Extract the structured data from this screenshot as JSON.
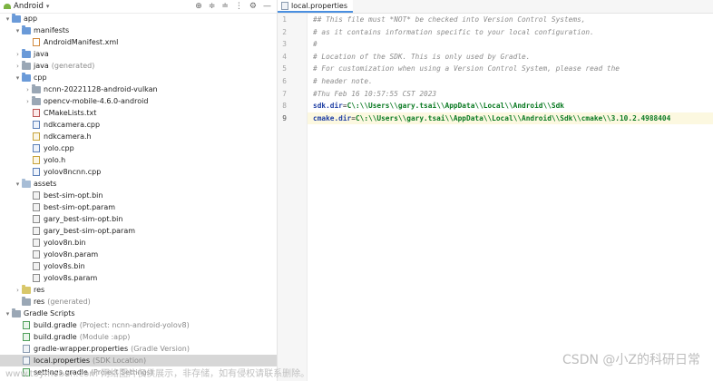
{
  "project_panel": {
    "view_selector": "Android",
    "tree": [
      {
        "depth": 0,
        "arrow": "▾",
        "icon": "folder-blue",
        "label": "app",
        "suffix": ""
      },
      {
        "depth": 1,
        "arrow": "▾",
        "icon": "folder-blue",
        "label": "manifests",
        "suffix": ""
      },
      {
        "depth": 2,
        "arrow": "",
        "icon": "file-xml",
        "label": "AndroidManifest.xml",
        "suffix": ""
      },
      {
        "depth": 1,
        "arrow": "›",
        "icon": "folder-blue",
        "label": "java",
        "suffix": ""
      },
      {
        "depth": 1,
        "arrow": "›",
        "icon": "folder-grey",
        "label": "java",
        "suffix": "(generated)"
      },
      {
        "depth": 1,
        "arrow": "▾",
        "icon": "folder-blue",
        "label": "cpp",
        "suffix": ""
      },
      {
        "depth": 2,
        "arrow": "›",
        "icon": "folder-grey",
        "label": "ncnn-20221128-android-vulkan",
        "suffix": ""
      },
      {
        "depth": 2,
        "arrow": "›",
        "icon": "folder-grey",
        "label": "opencv-mobile-4.6.0-android",
        "suffix": ""
      },
      {
        "depth": 2,
        "arrow": "",
        "icon": "file-txt",
        "label": "CMakeLists.txt",
        "suffix": ""
      },
      {
        "depth": 2,
        "arrow": "",
        "icon": "file-cpp",
        "label": "ndkcamera.cpp",
        "suffix": ""
      },
      {
        "depth": 2,
        "arrow": "",
        "icon": "file-h",
        "label": "ndkcamera.h",
        "suffix": ""
      },
      {
        "depth": 2,
        "arrow": "",
        "icon": "file-cpp",
        "label": "yolo.cpp",
        "suffix": ""
      },
      {
        "depth": 2,
        "arrow": "",
        "icon": "file-h",
        "label": "yolo.h",
        "suffix": ""
      },
      {
        "depth": 2,
        "arrow": "",
        "icon": "file-cpp",
        "label": "yolov8ncnn.cpp",
        "suffix": ""
      },
      {
        "depth": 1,
        "arrow": "▾",
        "icon": "folder-light",
        "label": "assets",
        "suffix": ""
      },
      {
        "depth": 2,
        "arrow": "",
        "icon": "file-bin",
        "label": "best-sim-opt.bin",
        "suffix": ""
      },
      {
        "depth": 2,
        "arrow": "",
        "icon": "file-bin",
        "label": "best-sim-opt.param",
        "suffix": ""
      },
      {
        "depth": 2,
        "arrow": "",
        "icon": "file-bin",
        "label": "gary_best-sim-opt.bin",
        "suffix": ""
      },
      {
        "depth": 2,
        "arrow": "",
        "icon": "file-bin",
        "label": "gary_best-sim-opt.param",
        "suffix": ""
      },
      {
        "depth": 2,
        "arrow": "",
        "icon": "file-bin",
        "label": "yolov8n.bin",
        "suffix": ""
      },
      {
        "depth": 2,
        "arrow": "",
        "icon": "file-bin",
        "label": "yolov8n.param",
        "suffix": ""
      },
      {
        "depth": 2,
        "arrow": "",
        "icon": "file-bin",
        "label": "yolov8s.bin",
        "suffix": ""
      },
      {
        "depth": 2,
        "arrow": "",
        "icon": "file-bin",
        "label": "yolov8s.param",
        "suffix": ""
      },
      {
        "depth": 1,
        "arrow": "›",
        "icon": "folder-yellow",
        "label": "res",
        "suffix": ""
      },
      {
        "depth": 1,
        "arrow": "",
        "icon": "folder-grey",
        "label": "res",
        "suffix": "(generated)"
      },
      {
        "depth": 0,
        "arrow": "▾",
        "icon": "folder-grey",
        "label": "Gradle Scripts",
        "suffix": ""
      },
      {
        "depth": 1,
        "arrow": "",
        "icon": "file-gradle",
        "label": "build.gradle",
        "suffix": "(Project: ncnn-android-yolov8)"
      },
      {
        "depth": 1,
        "arrow": "",
        "icon": "file-gradle",
        "label": "build.gradle",
        "suffix": "(Module :app)"
      },
      {
        "depth": 1,
        "arrow": "",
        "icon": "file-prop",
        "label": "gradle-wrapper.properties",
        "suffix": "(Gradle Version)"
      },
      {
        "depth": 1,
        "arrow": "",
        "icon": "file-prop",
        "label": "local.properties",
        "suffix": "(SDK Location)",
        "selected": true
      },
      {
        "depth": 1,
        "arrow": "",
        "icon": "file-gradle",
        "label": "settings.gradle",
        "suffix": "(Project Settings)"
      }
    ]
  },
  "editor": {
    "tab_label": "local.properties",
    "lines": [
      {
        "n": "1",
        "type": "comment",
        "text": "## This file must *NOT* be checked into Version Control Systems,"
      },
      {
        "n": "2",
        "type": "comment",
        "text": "# as it contains information specific to your local configuration."
      },
      {
        "n": "3",
        "type": "comment",
        "text": "#"
      },
      {
        "n": "4",
        "type": "comment",
        "text": "# Location of the SDK. This is only used by Gradle."
      },
      {
        "n": "5",
        "type": "comment",
        "text": "# For customization when using a Version Control System, please read the"
      },
      {
        "n": "6",
        "type": "comment",
        "text": "# header note."
      },
      {
        "n": "7",
        "type": "comment",
        "text": "#Thu Feb 16 10:57:55 CST 2023"
      },
      {
        "n": "8",
        "type": "prop",
        "key": "sdk.dir",
        "value": "C\\:\\\\Users\\\\gary.tsai\\\\AppData\\\\Local\\\\Android\\\\Sdk"
      },
      {
        "n": "9",
        "type": "prop",
        "key": "cmake.dir",
        "value": "C\\:\\\\Users\\\\gary.tsai\\\\AppData\\\\Local\\\\Android\\\\Sdk\\\\cmake\\\\3.10.2.4988404",
        "active": true
      }
    ]
  },
  "watermark_left": "www.toymoban.com 网络图片仅供展示，非存储，如有侵权请联系删除。",
  "watermark_right": "CSDN @小Z的科研日常",
  "colors": {
    "accent": "#4a8fe0",
    "comment": "#8c8c8c",
    "key": "#1f3fa4",
    "value": "#0a7a22",
    "selection": "#d7d7d7"
  }
}
